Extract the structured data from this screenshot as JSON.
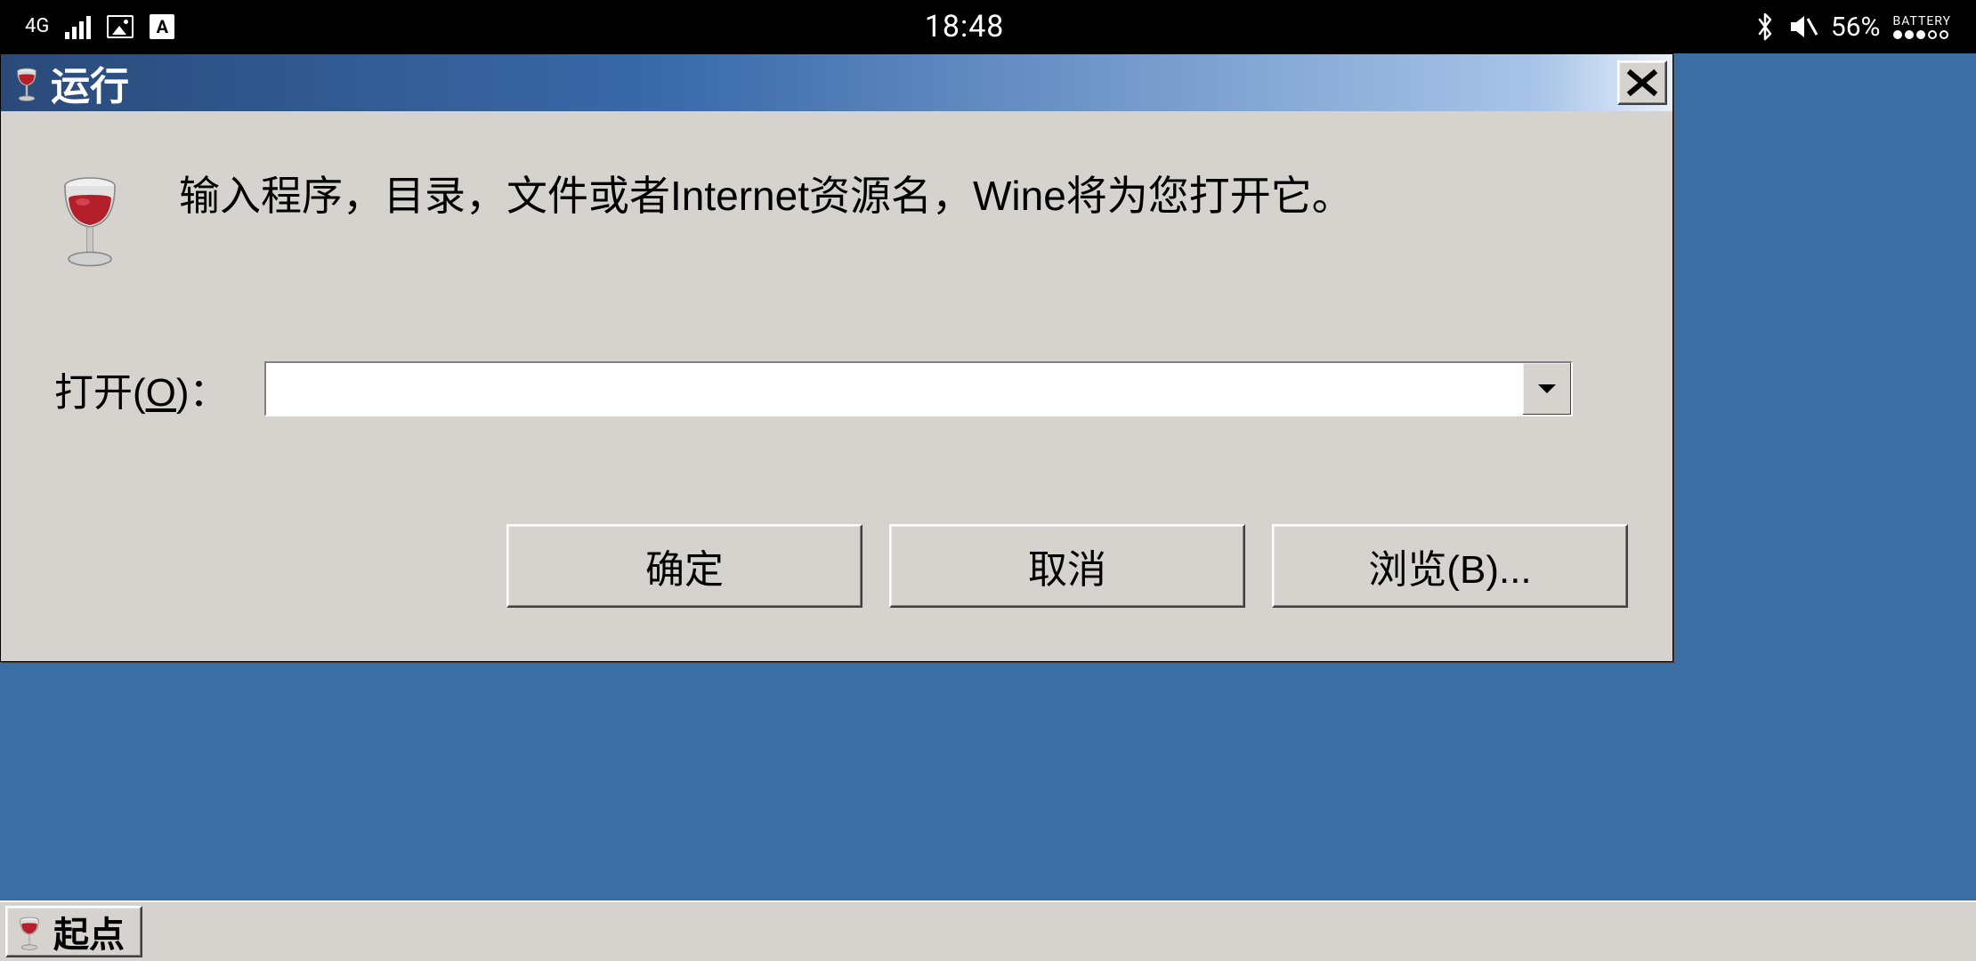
{
  "statusbar": {
    "network_label": "4G",
    "time": "18:48",
    "battery_percent": "56%",
    "battery_word": "BATTERY",
    "a_badge": "A"
  },
  "dialog": {
    "title": "运行",
    "description": "输入程序，目录，文件或者Internet资源名，Wine将为您打开它。",
    "open_label_pre": "打开(",
    "open_label_u": "O",
    "open_label_post": ")：",
    "input_value": "",
    "buttons": {
      "ok": "确定",
      "cancel": "取消",
      "browse": "浏览(B)..."
    }
  },
  "taskbar": {
    "start_label": "起点"
  }
}
